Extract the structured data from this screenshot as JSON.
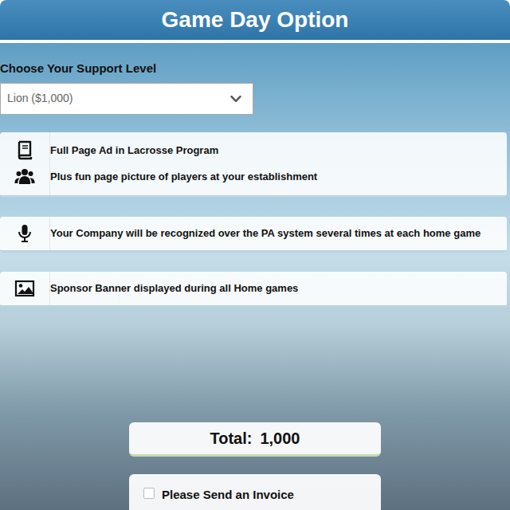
{
  "header": {
    "title": "Game Day Option"
  },
  "support": {
    "label": "Choose Your Support Level",
    "selected_option": "Lion ($1,000)"
  },
  "benefits": [
    {
      "lines": [
        "Full Page Ad in Lacrosse Program",
        "Plus fun page picture of players at your establishment"
      ]
    },
    {
      "lines": [
        "Your Company will be recognized over the PA system several times at each home game"
      ]
    },
    {
      "lines": [
        "Sponsor Banner displayed during all Home games"
      ]
    }
  ],
  "total": {
    "label": "Total:",
    "amount": "1,000"
  },
  "invoice": {
    "label": "Please Send an Invoice",
    "checked": false
  }
}
